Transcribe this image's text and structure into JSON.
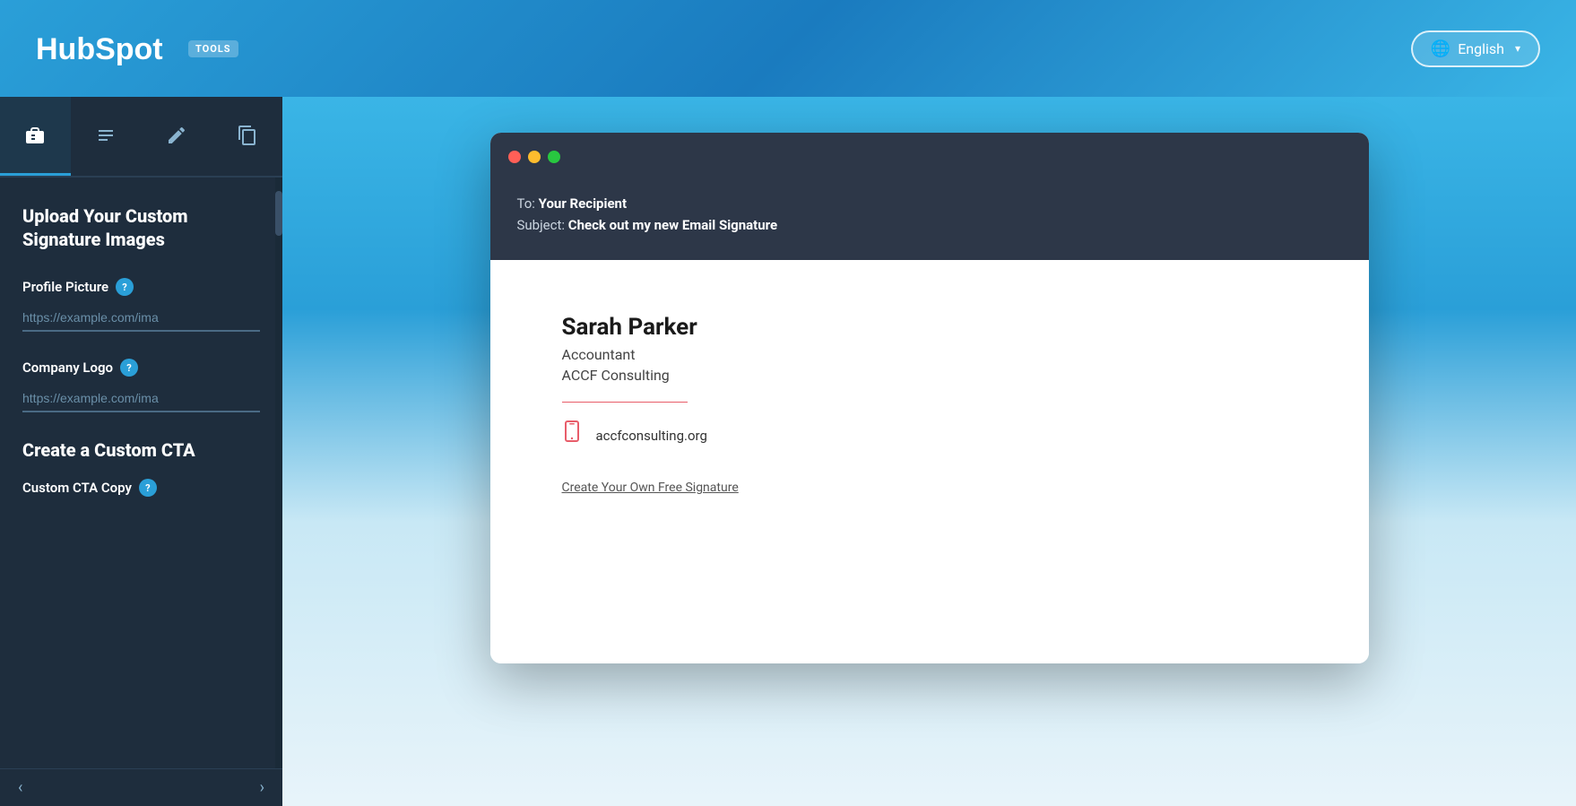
{
  "header": {
    "logo_text": "HubSpot",
    "logo_badge": "TOOLS",
    "language_label": "English"
  },
  "sidebar": {
    "tabs": [
      {
        "id": "briefcase",
        "icon": "💼",
        "active": true
      },
      {
        "id": "text",
        "icon": "≡",
        "active": false
      },
      {
        "id": "pen",
        "icon": "✏️",
        "active": false
      },
      {
        "id": "copy",
        "icon": "⧉",
        "active": false
      }
    ],
    "section_title": "Upload Your Custom Signature Images",
    "profile_picture": {
      "label": "Profile Picture",
      "placeholder": "https://example.com/ima"
    },
    "company_logo": {
      "label": "Company Logo",
      "placeholder": "https://example.com/ima"
    },
    "cta_section_title": "Create a Custom CTA",
    "custom_cta_copy": {
      "label": "Custom CTA Copy"
    }
  },
  "email_preview": {
    "to_label": "To:",
    "to_value": "Your Recipient",
    "subject_label": "Subject:",
    "subject_value": "Check out my new Email Signature",
    "signature": {
      "name": "Sarah Parker",
      "title": "Accountant",
      "company": "ACCF Consulting",
      "website": "accfconsulting.org",
      "cta_link": "Create Your Own Free Signature"
    }
  }
}
